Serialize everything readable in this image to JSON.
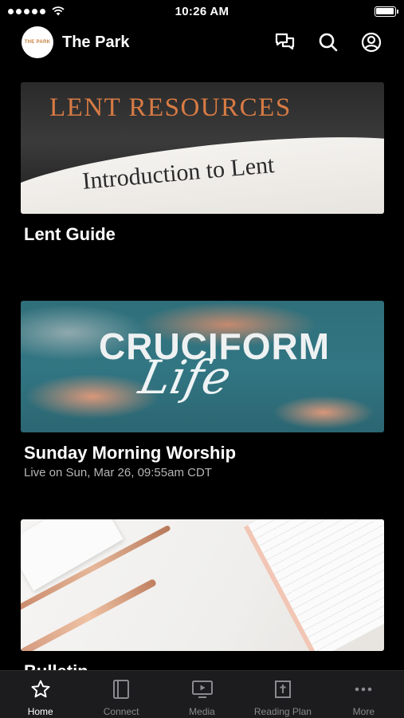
{
  "status_bar": {
    "time": "10:26 AM",
    "battery_level": 1.0
  },
  "header": {
    "title": "The Park",
    "logo_text": "THE PARK",
    "icons": [
      "chat-icon",
      "search-icon",
      "account-icon"
    ]
  },
  "cards": [
    {
      "title": "Lent Guide",
      "subtitle": "",
      "image": {
        "heading": "LENT RESOURCES",
        "body": "Introduction to Lent"
      }
    },
    {
      "title": "Sunday Morning Worship",
      "subtitle": "Live on Sun, Mar 26, 09:55am CDT",
      "image": {
        "heading": "CRUCIFORM",
        "script": "Life"
      }
    },
    {
      "title": "Bulletin",
      "subtitle": ""
    }
  ],
  "tabs": [
    {
      "label": "Home",
      "icon": "star-icon",
      "active": true
    },
    {
      "label": "Connect",
      "icon": "book-icon",
      "active": false
    },
    {
      "label": "Media",
      "icon": "tv-icon",
      "active": false
    },
    {
      "label": "Reading Plan",
      "icon": "bible-icon",
      "active": false
    },
    {
      "label": "More",
      "icon": "more-icon",
      "active": false
    }
  ],
  "colors": {
    "background": "#000000",
    "tab_bar": "#1c1c1e",
    "inactive_tab": "#8a8a8e",
    "subtitle": "#b5b5b5",
    "lent_accent": "#d87b44"
  }
}
